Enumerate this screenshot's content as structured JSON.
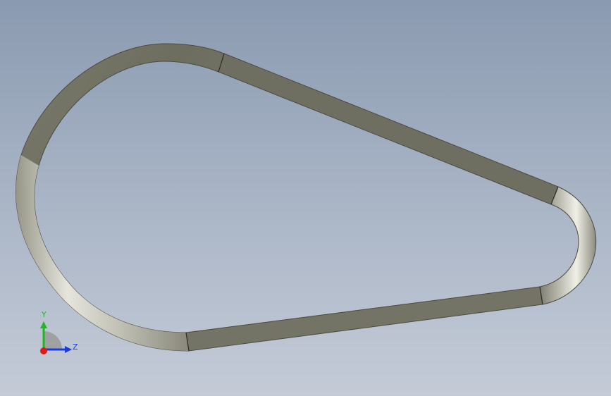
{
  "viewport": {
    "background_top": "#8a9ab0",
    "background_bottom": "#c4cbd7"
  },
  "model": {
    "name": "belt",
    "segments": [
      "large-pulley-arc",
      "upper-straight",
      "small-pulley-arc",
      "lower-straight"
    ]
  },
  "triad": {
    "y_label": "Y",
    "z_label": "Z",
    "colors": {
      "y": "#1fb81f",
      "z": "#1a3ae0",
      "x": "#e01a1a"
    }
  }
}
